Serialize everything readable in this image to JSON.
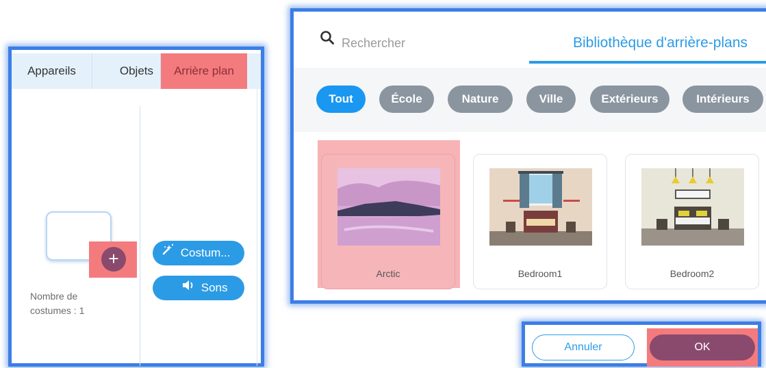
{
  "left_panel": {
    "tabs": [
      {
        "label": "Appareils"
      },
      {
        "label": "Objets"
      },
      {
        "label": "Arrière plan"
      }
    ],
    "costume_count": "Nombre de costumes : 1",
    "add_button_symbol": "+",
    "costumes_button": {
      "label": "Costum...",
      "icon": "magic-wand-icon"
    },
    "sounds_button": {
      "label": "Sons",
      "icon": "speaker-icon"
    }
  },
  "library": {
    "search_placeholder": "Rechercher",
    "title": "Bibliothèque d'arrière-plans",
    "filters": [
      {
        "label": "Tout",
        "active": true
      },
      {
        "label": "École",
        "active": false
      },
      {
        "label": "Nature",
        "active": false
      },
      {
        "label": "Ville",
        "active": false
      },
      {
        "label": "Extérieurs",
        "active": false
      },
      {
        "label": "Intérieurs",
        "active": false
      }
    ],
    "items": [
      {
        "name": "Arctic",
        "selected": true
      },
      {
        "name": "Bedroom1",
        "selected": false
      },
      {
        "name": "Bedroom2",
        "selected": false
      }
    ]
  },
  "dialog": {
    "cancel_label": "Annuler",
    "ok_label": "OK"
  },
  "colors": {
    "accent": "#2c9be6",
    "highlight": "#f47b7d",
    "ok": "#8a4a6e",
    "chip_inactive": "#8a95a0",
    "frame": "#3d7ee6"
  }
}
